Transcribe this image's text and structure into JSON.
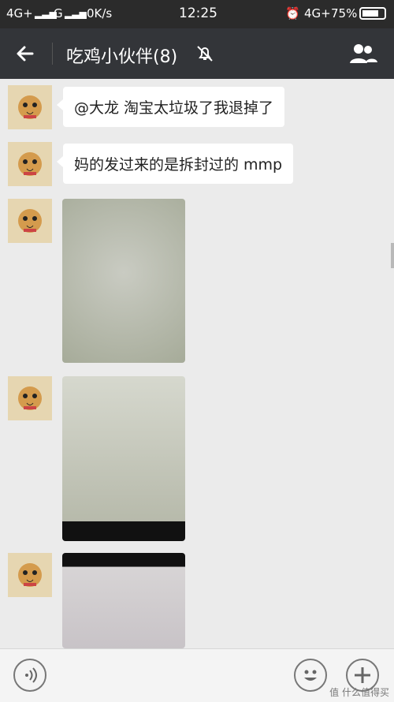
{
  "status_bar": {
    "left_signal_1": "4G+",
    "left_signal_2": "G",
    "speed": "0K/s",
    "time": "12:25",
    "right_network": "4G+",
    "battery": "75%"
  },
  "header": {
    "title": "吃鸡小伙伴(8)"
  },
  "messages": [
    {
      "type": "text",
      "text": "@大龙  淘宝太垃圾了我退掉了"
    },
    {
      "type": "text",
      "text": "妈的发过来的是拆封过的 mmp"
    },
    {
      "type": "image"
    },
    {
      "type": "image"
    },
    {
      "type": "image"
    }
  ],
  "watermark": "值 什么值得买",
  "icons": {
    "back": "back-arrow-icon",
    "mute": "mute-bell-icon",
    "members": "group-members-icon",
    "voice": "voice-input-icon",
    "emoji": "emoji-icon",
    "more": "plus-icon"
  }
}
